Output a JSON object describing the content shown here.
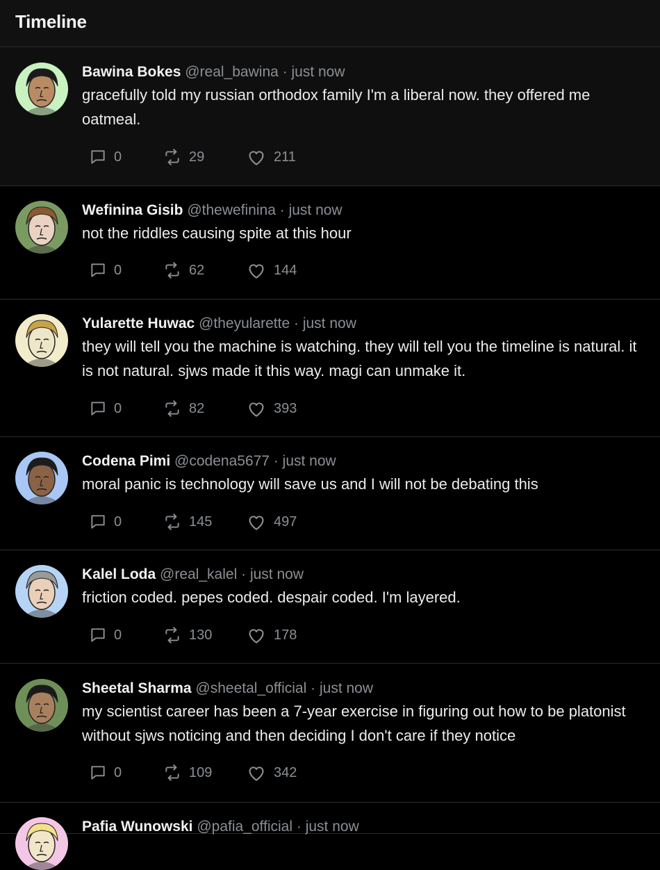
{
  "header": {
    "title": "Timeline"
  },
  "posts": [
    {
      "name": "Bawina Bokes",
      "handle": "@real_bawina",
      "separator": "·",
      "time": "just now",
      "text": "gracefully told my russian orthodox family I'm a liberal now. they offered me oatmeal.",
      "replies": "0",
      "retweets": "29",
      "likes": "211",
      "avatar_bg": "#c8f2c0",
      "avatar_skin": "#b98b63",
      "avatar_hair": "#1a1a1a"
    },
    {
      "name": "Wefinina Gisib",
      "handle": "@thewefinina",
      "separator": "·",
      "time": "just now",
      "text": "not the riddles causing spite at this hour",
      "replies": "0",
      "retweets": "62",
      "likes": "144",
      "avatar_bg": "#7a9a62",
      "avatar_skin": "#e9d2c2",
      "avatar_hair": "#8a5a32"
    },
    {
      "name": "Yularette Huwac",
      "handle": "@theyularette",
      "separator": "·",
      "time": "just now",
      "text": "they will tell you the machine is watching. they will tell you the timeline is natural. it is not natural. sjws made it this way. magi can unmake it.",
      "replies": "0",
      "retweets": "82",
      "likes": "393",
      "avatar_bg": "#f2eccb",
      "avatar_skin": "#eee6c8",
      "avatar_hair": "#c8a24a"
    },
    {
      "name": "Codena Pimi",
      "handle": "@codena5677",
      "separator": "·",
      "time": "just now",
      "text": "moral panic is technology will save us and I will not be debating this",
      "replies": "0",
      "retweets": "145",
      "likes": "497",
      "avatar_bg": "#a9c7f5",
      "avatar_skin": "#8a6246",
      "avatar_hair": "#1c1c1c"
    },
    {
      "name": "Kalel Loda",
      "handle": "@real_kalel",
      "separator": "·",
      "time": "just now",
      "text": "friction coded. pepes coded. despair coded. I'm layered.",
      "replies": "0",
      "retweets": "130",
      "likes": "178",
      "avatar_bg": "#b6d4f5",
      "avatar_skin": "#ead0b8",
      "avatar_hair": "#9a9a9a"
    },
    {
      "name": "Sheetal Sharma",
      "handle": "@sheetal_official",
      "separator": "·",
      "time": "just now",
      "text": "my scientist career has been a 7-year exercise in figuring out how to be platonist without sjws noticing and then deciding I don't care if they notice",
      "replies": "0",
      "retweets": "109",
      "likes": "342",
      "avatar_bg": "#6f8f58",
      "avatar_skin": "#a9805e",
      "avatar_hair": "#1a1a1a"
    },
    {
      "name": "Pafia Wunowski",
      "handle": "@pafia_official",
      "separator": "·",
      "time": "just now",
      "text": "",
      "replies": "",
      "retweets": "",
      "likes": "",
      "avatar_bg": "#f4c6e6",
      "avatar_skin": "#f2e6c8",
      "avatar_hair": "#f3e08a"
    }
  ]
}
